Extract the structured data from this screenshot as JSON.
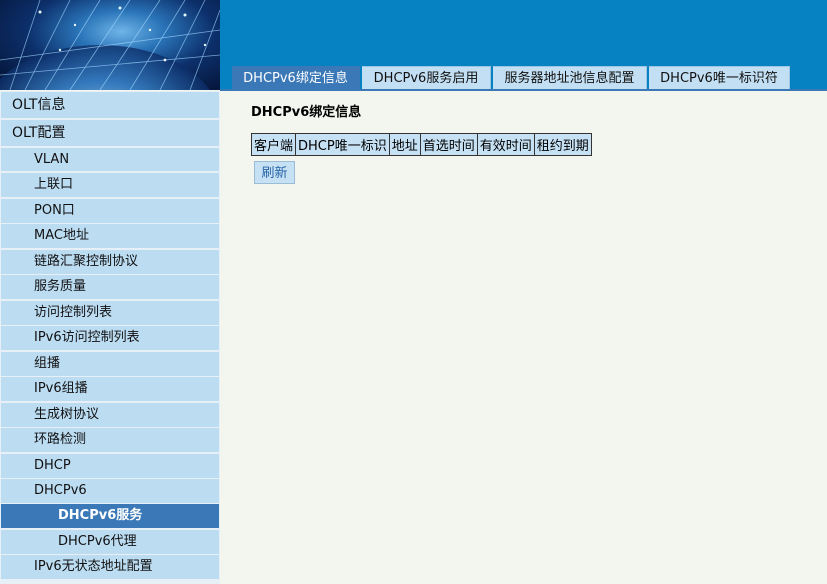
{
  "tabs": [
    {
      "label": "DHCPv6绑定信息",
      "active": true
    },
    {
      "label": "DHCPv6服务启用",
      "active": false
    },
    {
      "label": "服务器地址池信息配置",
      "active": false
    },
    {
      "label": "DHCPv6唯一标识符",
      "active": false
    }
  ],
  "sidebar": {
    "items": [
      {
        "label": "OLT信息",
        "level": 1
      },
      {
        "label": "OLT配置",
        "level": 1
      },
      {
        "label": "VLAN",
        "level": 2
      },
      {
        "label": "上联口",
        "level": 2
      },
      {
        "label": "PON口",
        "level": 2
      },
      {
        "label": "MAC地址",
        "level": 2
      },
      {
        "label": "链路汇聚控制协议",
        "level": 2
      },
      {
        "label": "服务质量",
        "level": 2
      },
      {
        "label": "访问控制列表",
        "level": 2
      },
      {
        "label": "IPv6访问控制列表",
        "level": 2
      },
      {
        "label": "组播",
        "level": 2
      },
      {
        "label": "IPv6组播",
        "level": 2
      },
      {
        "label": "生成树协议",
        "level": 2
      },
      {
        "label": "环路检测",
        "level": 2
      },
      {
        "label": "DHCP",
        "level": 2
      },
      {
        "label": "DHCPv6",
        "level": 2
      },
      {
        "label": "DHCPv6服务",
        "level": 3,
        "active": true
      },
      {
        "label": "DHCPv6代理",
        "level": 3
      },
      {
        "label": "IPv6无状态地址配置",
        "level": 2
      }
    ]
  },
  "main": {
    "title": "DHCPv6绑定信息",
    "table": {
      "columns": [
        "客户端",
        "DHCP唯一标识",
        "地址",
        "首选时间",
        "有效时间",
        "租约到期"
      ]
    },
    "refresh_label": "刷新"
  },
  "colors": {
    "header_blue": "#0682c2",
    "active_blue": "#3a78b7",
    "light_blue": "#bcdcf2",
    "content_bg": "#f3f6ef"
  }
}
